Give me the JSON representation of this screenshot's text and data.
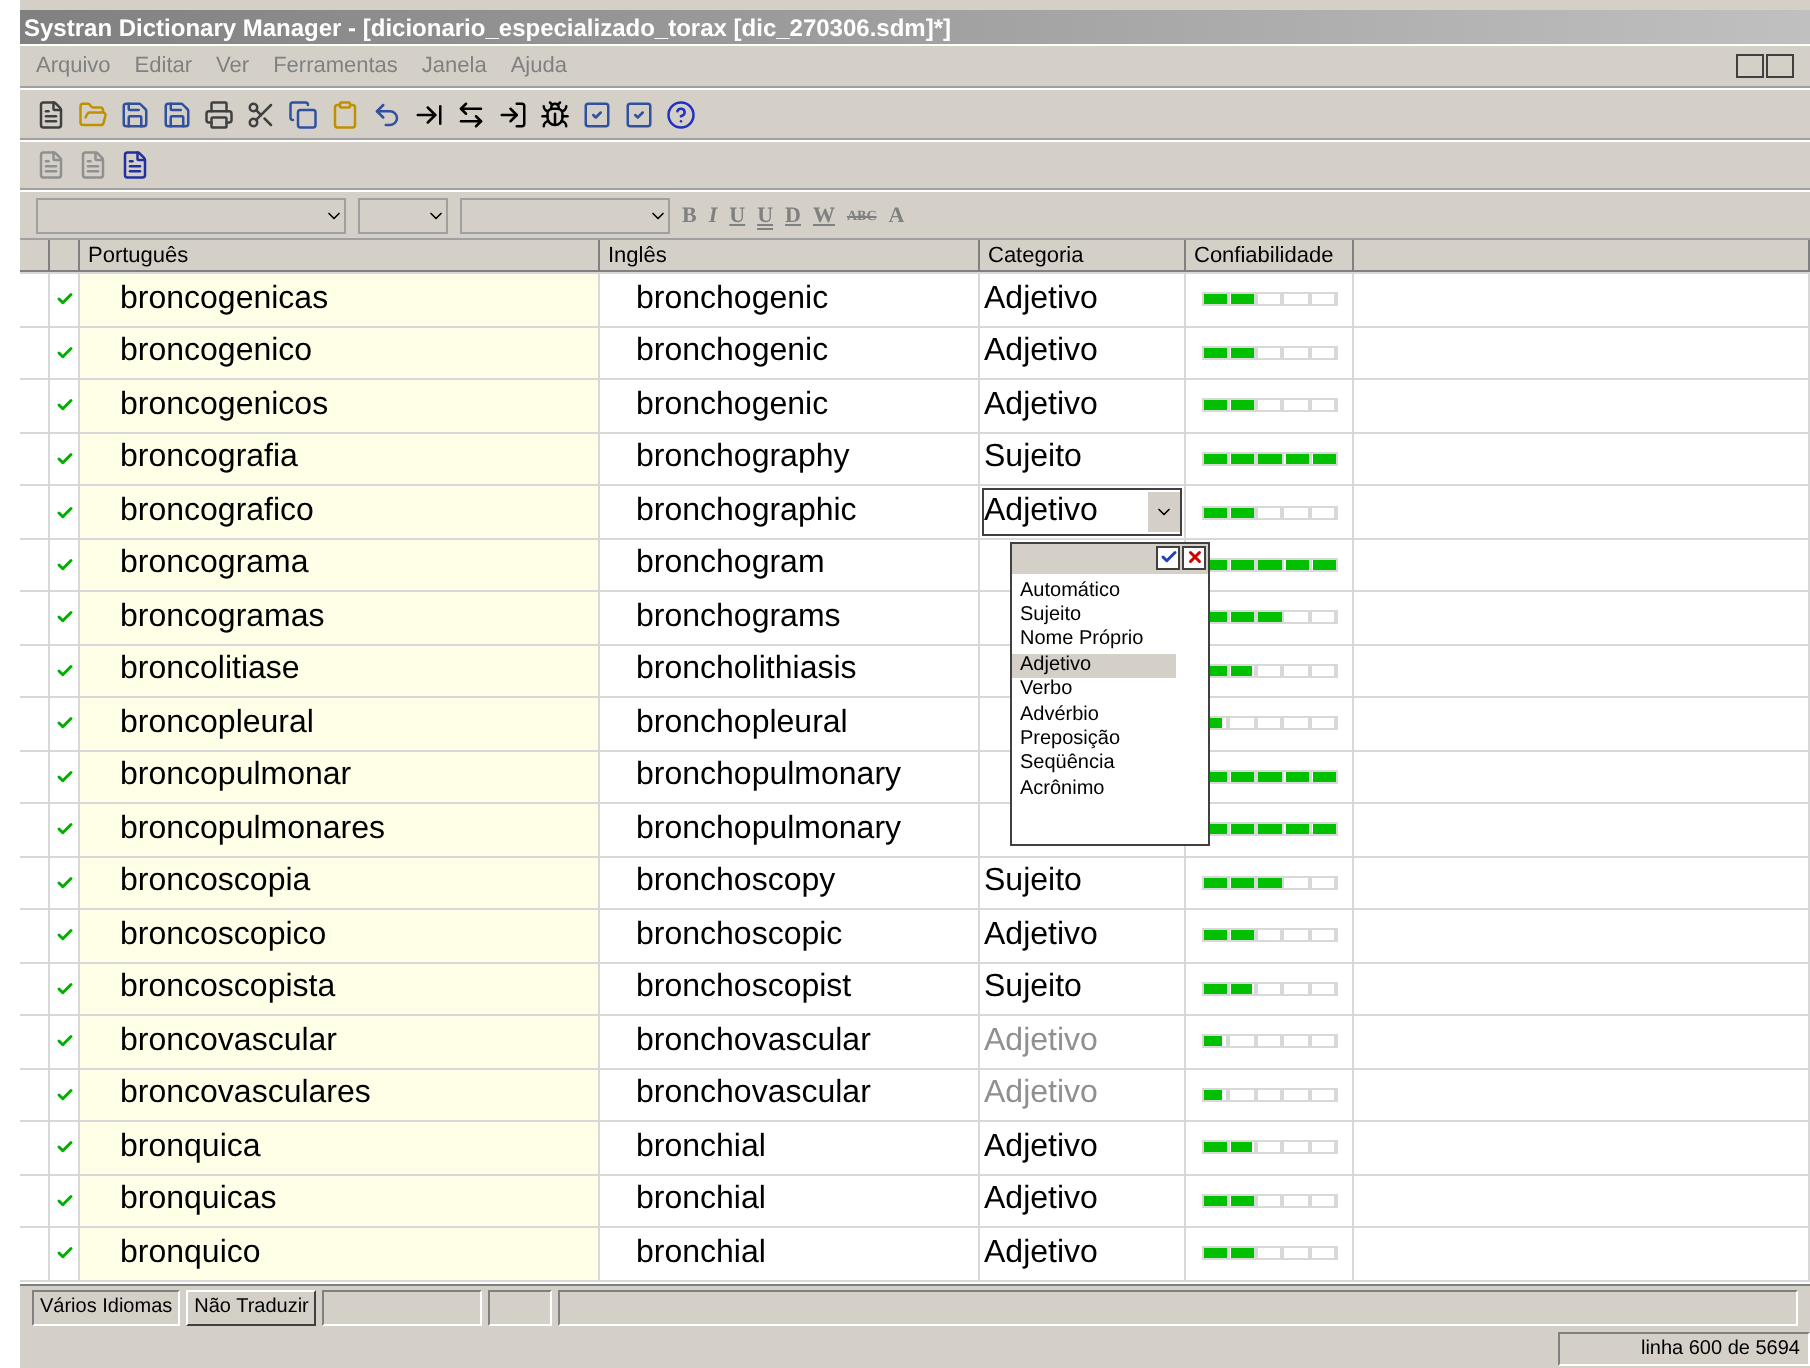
{
  "window": {
    "title": "Systran Dictionary Manager - [dicionario_especializado_torax [dic_270306.sdm]*]"
  },
  "menu": [
    "Arquivo",
    "Editar",
    "Ver",
    "Ferramentas",
    "Janela",
    "Ajuda"
  ],
  "format_buttons": [
    {
      "label": "B",
      "kind": "bold"
    },
    {
      "label": "I",
      "kind": "italic"
    },
    {
      "label": "U",
      "kind": "underline"
    },
    {
      "label": "U",
      "kind": "double"
    },
    {
      "label": "D",
      "kind": "underline"
    },
    {
      "label": "W",
      "kind": "underline"
    },
    {
      "label": "ABC",
      "kind": "strike"
    },
    {
      "label": "A",
      "kind": "color"
    }
  ],
  "table": {
    "columns": [
      "Português",
      "Inglês",
      "Categoria",
      "Confiabilidade"
    ],
    "rows": [
      {
        "checked": true,
        "pt": "broncogenicas",
        "en": "bronchogenic",
        "category": "Adjetivo",
        "dimmed": false,
        "level": 0.4
      },
      {
        "checked": true,
        "pt": "broncogenico",
        "en": "bronchogenic",
        "category": "Adjetivo",
        "dimmed": false,
        "level": 0.4
      },
      {
        "checked": true,
        "pt": "broncogenicos",
        "en": "bronchogenic",
        "category": "Adjetivo",
        "dimmed": false,
        "level": 0.4
      },
      {
        "checked": true,
        "pt": "broncografia",
        "en": "bronchography",
        "category": "Sujeito",
        "dimmed": false,
        "level": 1
      },
      {
        "checked": true,
        "pt": "broncografico",
        "en": "bronchographic",
        "category": "Adjetivo",
        "editing": true,
        "level": 0.4
      },
      {
        "checked": true,
        "pt": "broncograma",
        "en": "bronchogram",
        "level": 1
      },
      {
        "checked": true,
        "pt": "broncogramas",
        "en": "bronchograms",
        "level": 0.6
      },
      {
        "checked": true,
        "pt": "broncolitiase",
        "en": "broncholithiasis",
        "level": 0.37
      },
      {
        "checked": true,
        "pt": "broncopleural",
        "en": "bronchopleural",
        "level": 0.15
      },
      {
        "checked": true,
        "pt": "broncopulmonar",
        "en": "bronchopulmonary",
        "level": 1
      },
      {
        "checked": true,
        "pt": "broncopulmonares",
        "en": "bronchopulmonary",
        "level": 1
      },
      {
        "checked": true,
        "pt": "broncoscopia",
        "en": "bronchoscopy",
        "category": "Sujeito",
        "dimmed": false,
        "level": 0.6
      },
      {
        "checked": true,
        "pt": "broncoscopico",
        "en": "bronchoscopic",
        "category": "Adjetivo",
        "dimmed": false,
        "level": 0.4
      },
      {
        "checked": true,
        "pt": "broncoscopista",
        "en": "bronchoscopist",
        "category": "Sujeito",
        "dimmed": false,
        "level": 0.37
      },
      {
        "checked": true,
        "pt": "broncovascular",
        "en": "bronchovascular",
        "category": "Adjetivo",
        "dimmed": true,
        "level": 0.15
      },
      {
        "checked": true,
        "pt": "broncovasculares",
        "en": "bronchovascular",
        "category": "Adjetivo",
        "dimmed": true,
        "level": 0.15
      },
      {
        "checked": true,
        "pt": "bronquica",
        "en": "bronchial",
        "category": "Adjetivo",
        "dimmed": false,
        "level": 0.37
      },
      {
        "checked": true,
        "pt": "bronquicas",
        "en": "bronchial",
        "category": "Adjetivo",
        "dimmed": false,
        "level": 0.4
      },
      {
        "checked": true,
        "pt": "bronquico",
        "en": "bronchial",
        "category": "Adjetivo",
        "dimmed": false,
        "level": 0.4
      }
    ]
  },
  "dropdown": {
    "options": [
      {
        "label": "Automático",
        "selected": false
      },
      {
        "label": "Sujeito",
        "selected": false
      },
      {
        "label": "Nome Próprio",
        "selected": false
      },
      {
        "label": "Adjetivo",
        "selected": true
      },
      {
        "label": "Verbo",
        "selected": false
      },
      {
        "label": "Advérbio",
        "selected": false
      },
      {
        "label": "Preposição",
        "selected": false
      },
      {
        "label": "Seqüência",
        "selected": false
      },
      {
        "label": "Acrônimo",
        "selected": false
      }
    ]
  },
  "bottom_tabs": [
    {
      "label": "Vários Idiomas",
      "selected": true
    },
    {
      "label": "Não Traduzir",
      "selected": false
    }
  ],
  "status_bar": {
    "position": "linha  600 de 5694"
  }
}
